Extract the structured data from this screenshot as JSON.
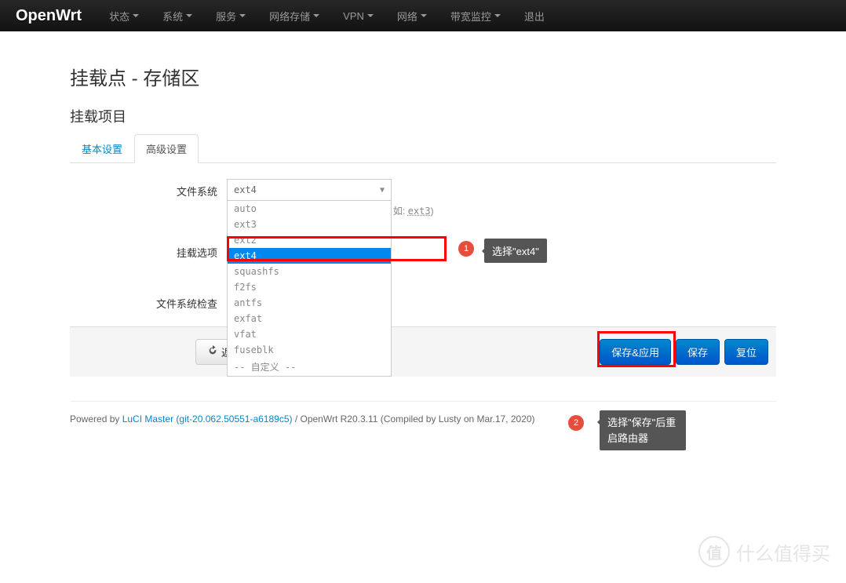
{
  "navbar": {
    "brand": "OpenWrt",
    "items": [
      "状态",
      "系统",
      "服务",
      "网络存储",
      "VPN",
      "网络",
      "带宽监控",
      "退出"
    ],
    "has_caret": [
      true,
      true,
      true,
      true,
      true,
      true,
      true,
      false
    ]
  },
  "page": {
    "title": "挂载点 - 存储区",
    "section": "挂载项目"
  },
  "tabs": [
    {
      "label": "基本设置",
      "active": false
    },
    {
      "label": "高级设置",
      "active": true
    }
  ],
  "form": {
    "filesystem": {
      "label": "文件系统",
      "value": "ext4",
      "hint_prefix": "如: ",
      "hint_code": "ext3",
      "hint_suffix": ")",
      "options": [
        "auto",
        "ext3",
        "ext2",
        "ext4",
        "squashfs",
        "f2fs",
        "antfs",
        "exfat",
        "vfat",
        "fuseblk",
        "-- 自定义 --"
      ],
      "highlighted": "ext4"
    },
    "mount_options": {
      "label": "挂载选项"
    },
    "fscheck": {
      "label": "文件系统检查"
    }
  },
  "actions": {
    "back": "返回至概况",
    "save_apply": "保存&应用",
    "save": "保存",
    "reset": "复位"
  },
  "footer": {
    "prefix": "Powered by ",
    "link": "LuCI Master (git-20.062.50551-a6189c5)",
    "suffix": " / OpenWrt R20.3.11 (Compiled by Lusty on Mar.17, 2020)"
  },
  "annotations": {
    "badge1": "1",
    "tip1": "选择\"ext4\"",
    "badge2": "2",
    "tip2": "选择\"保存\"后重启路由器"
  },
  "watermark": {
    "icon": "值",
    "text": "什么值得买"
  }
}
